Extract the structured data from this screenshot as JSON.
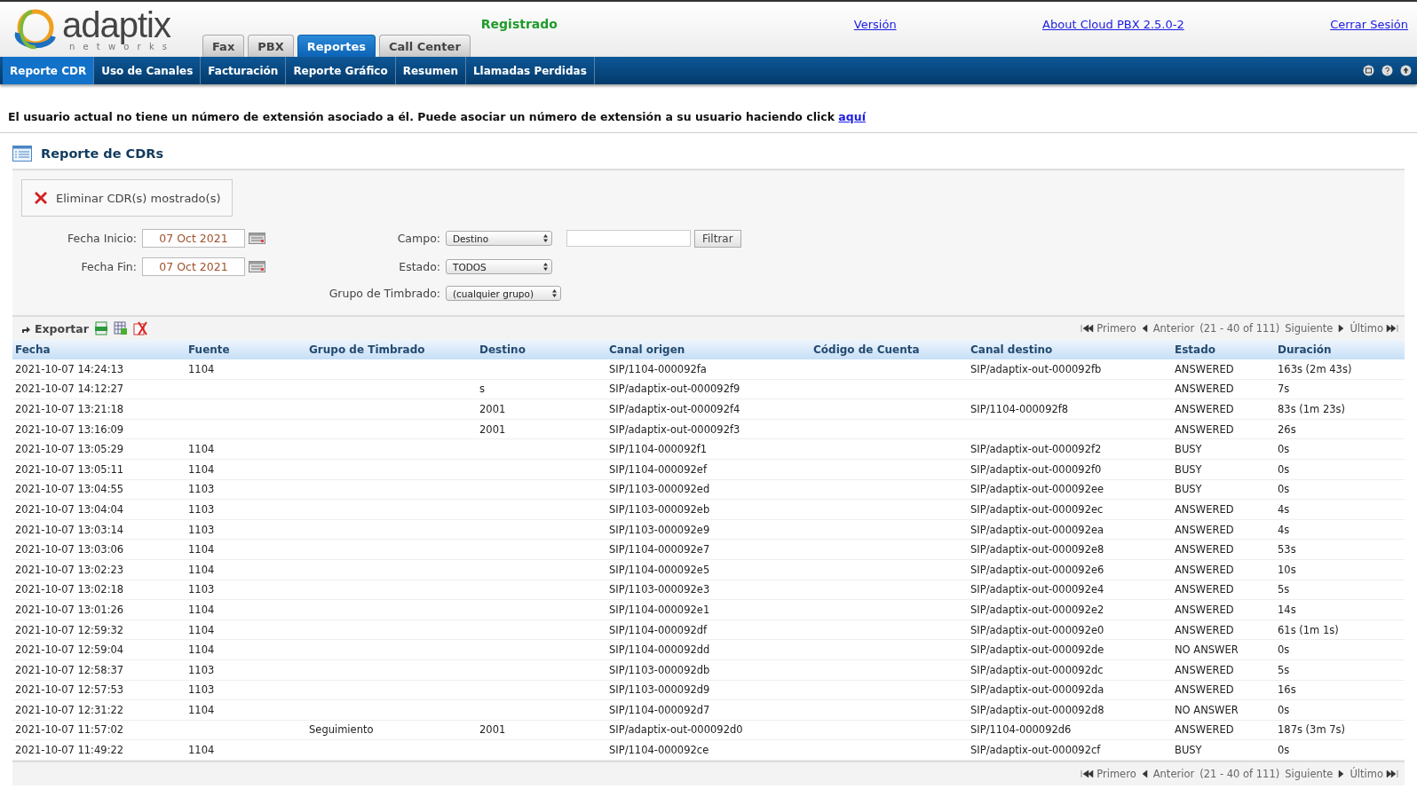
{
  "header": {
    "logo": {
      "name": "adaptix",
      "tagline": "n e t w o r k s"
    },
    "status": "Registrado",
    "links": [
      "Versión",
      "About Cloud PBX 2.5.0-2",
      "Cerrar Sesión"
    ]
  },
  "tabs": [
    {
      "label": "Fax",
      "selected": false
    },
    {
      "label": "PBX",
      "selected": false
    },
    {
      "label": "Reportes",
      "selected": true
    },
    {
      "label": "Call Center",
      "selected": false
    }
  ],
  "subnav": [
    {
      "label": "Reporte CDR",
      "selected": true
    },
    {
      "label": "Uso de Canales",
      "selected": false
    },
    {
      "label": "Facturación",
      "selected": false
    },
    {
      "label": "Reporte Gráfico",
      "selected": false
    },
    {
      "label": "Resumen",
      "selected": false
    },
    {
      "label": "Llamadas Perdidas",
      "selected": false
    }
  ],
  "notice": {
    "text": "El usuario actual no tiene un número de extensión asociado a él. Puede asociar un número de extensión a su usuario haciendo click",
    "link": "aquí"
  },
  "title": "Reporte de CDRs",
  "delete_button": "Eliminar CDR(s) mostrado(s)",
  "filters": {
    "fecha_inicio": {
      "label": "Fecha Inicio:",
      "value": "07 Oct 2021"
    },
    "fecha_fin": {
      "label": "Fecha Fin:",
      "value": "07 Oct 2021"
    },
    "campo": {
      "label": "Campo:",
      "value": "Destino"
    },
    "estado": {
      "label": "Estado:",
      "value": "TODOS"
    },
    "grupo": {
      "label": "Grupo de Timbrado:",
      "value": "(cualquier grupo)"
    },
    "filter_button": "Filtrar"
  },
  "export": "Exportar",
  "pagination_top": {
    "first": "Primero",
    "prev": "Anterior",
    "range": "(21 - 40 of 111)",
    "next": "Siguiente",
    "last": "Último"
  },
  "pagination_bottom": {
    "first": "Primero",
    "prev": "Anterior",
    "range": "(21 - 40 of 111)",
    "next": "Siguiente",
    "last": "Último"
  },
  "table": {
    "columns": [
      "Fecha",
      "Fuente",
      "Grupo de Timbrado",
      "Destino",
      "Canal origen",
      "Código de Cuenta",
      "Canal destino",
      "Estado",
      "Duración"
    ],
    "rows": [
      [
        "2021-10-07 14:24:13",
        "1104",
        "",
        "",
        "SIP/1104-000092fa",
        "",
        "SIP/adaptix-out-000092fb",
        "ANSWERED",
        "163s (2m 43s)"
      ],
      [
        "2021-10-07 14:12:27",
        "",
        "",
        "s",
        "SIP/adaptix-out-000092f9",
        "",
        "",
        "ANSWERED",
        "7s"
      ],
      [
        "2021-10-07 13:21:18",
        "",
        "",
        "2001",
        "SIP/adaptix-out-000092f4",
        "",
        "SIP/1104-000092f8",
        "ANSWERED",
        "83s (1m 23s)"
      ],
      [
        "2021-10-07 13:16:09",
        "",
        "",
        "2001",
        "SIP/adaptix-out-000092f3",
        "",
        "",
        "ANSWERED",
        "26s"
      ],
      [
        "2021-10-07 13:05:29",
        "1104",
        "",
        "",
        "SIP/1104-000092f1",
        "",
        "SIP/adaptix-out-000092f2",
        "BUSY",
        "0s"
      ],
      [
        "2021-10-07 13:05:11",
        "1104",
        "",
        "",
        "SIP/1104-000092ef",
        "",
        "SIP/adaptix-out-000092f0",
        "BUSY",
        "0s"
      ],
      [
        "2021-10-07 13:04:55",
        "1103",
        "",
        "",
        "SIP/1103-000092ed",
        "",
        "SIP/adaptix-out-000092ee",
        "BUSY",
        "0s"
      ],
      [
        "2021-10-07 13:04:04",
        "1103",
        "",
        "",
        "SIP/1103-000092eb",
        "",
        "SIP/adaptix-out-000092ec",
        "ANSWERED",
        "4s"
      ],
      [
        "2021-10-07 13:03:14",
        "1103",
        "",
        "",
        "SIP/1103-000092e9",
        "",
        "SIP/adaptix-out-000092ea",
        "ANSWERED",
        "4s"
      ],
      [
        "2021-10-07 13:03:06",
        "1104",
        "",
        "",
        "SIP/1104-000092e7",
        "",
        "SIP/adaptix-out-000092e8",
        "ANSWERED",
        "53s"
      ],
      [
        "2021-10-07 13:02:23",
        "1104",
        "",
        "",
        "SIP/1104-000092e5",
        "",
        "SIP/adaptix-out-000092e6",
        "ANSWERED",
        "10s"
      ],
      [
        "2021-10-07 13:02:18",
        "1103",
        "",
        "",
        "SIP/1103-000092e3",
        "",
        "SIP/adaptix-out-000092e4",
        "ANSWERED",
        "5s"
      ],
      [
        "2021-10-07 13:01:26",
        "1104",
        "",
        "",
        "SIP/1104-000092e1",
        "",
        "SIP/adaptix-out-000092e2",
        "ANSWERED",
        "14s"
      ],
      [
        "2021-10-07 12:59:32",
        "1104",
        "",
        "",
        "SIP/1104-000092df",
        "",
        "SIP/adaptix-out-000092e0",
        "ANSWERED",
        "61s (1m 1s)"
      ],
      [
        "2021-10-07 12:59:04",
        "1104",
        "",
        "",
        "SIP/1104-000092dd",
        "",
        "SIP/adaptix-out-000092de",
        "NO ANSWER",
        "0s"
      ],
      [
        "2021-10-07 12:58:37",
        "1103",
        "",
        "",
        "SIP/1103-000092db",
        "",
        "SIP/adaptix-out-000092dc",
        "ANSWERED",
        "5s"
      ],
      [
        "2021-10-07 12:57:53",
        "1103",
        "",
        "",
        "SIP/1103-000092d9",
        "",
        "SIP/adaptix-out-000092da",
        "ANSWERED",
        "16s"
      ],
      [
        "2021-10-07 12:31:22",
        "1104",
        "",
        "",
        "SIP/1104-000092d7",
        "",
        "SIP/adaptix-out-000092d8",
        "NO ANSWER",
        "0s"
      ],
      [
        "2021-10-07 11:57:02",
        "",
        "Seguimiento",
        "2001",
        "SIP/adaptix-out-000092d0",
        "",
        "SIP/1104-000092d6",
        "ANSWERED",
        "187s (3m 7s)"
      ],
      [
        "2021-10-07 11:49:22",
        "1104",
        "",
        "",
        "SIP/1104-000092ce",
        "",
        "SIP/adaptix-out-000092cf",
        "BUSY",
        "0s"
      ]
    ]
  }
}
